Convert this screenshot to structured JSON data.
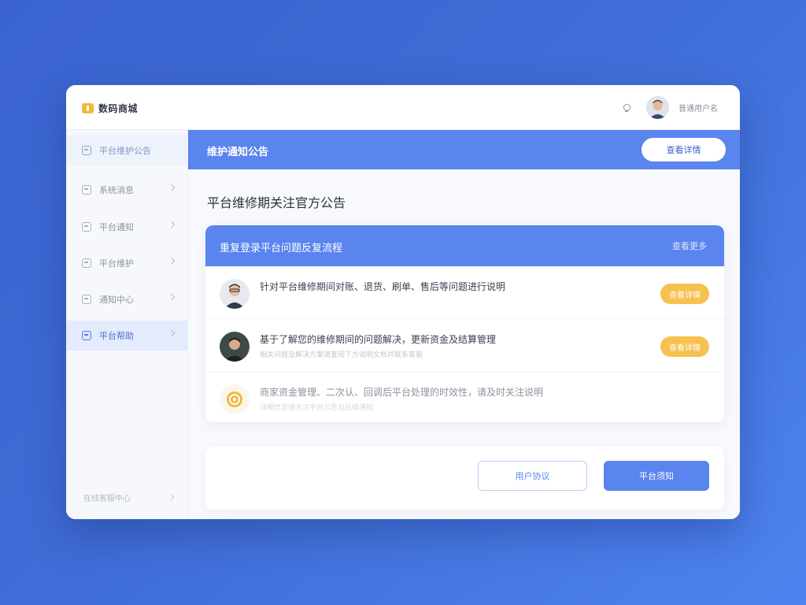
{
  "app": {
    "title": "数码商城"
  },
  "header": {
    "username": "普通用户名"
  },
  "sidebar": {
    "items": [
      {
        "label": "平台维护公告",
        "active": false
      },
      {
        "label": "系统消息",
        "active": false
      },
      {
        "label": "平台通知",
        "active": false
      },
      {
        "label": "平台维护",
        "active": false
      },
      {
        "label": "通知中心",
        "active": false
      },
      {
        "label": "平台帮助",
        "active": true
      }
    ],
    "footer": "在线客服中心"
  },
  "banner": {
    "title": "维护通知公告",
    "button_label": "查看详情"
  },
  "page_title": "平台维修期关注官方公告",
  "card": {
    "title": "重复登录平台问题反复流程",
    "link": "查看更多",
    "rows": [
      {
        "text": "针对平台维修期间对账、退货、刷单、售后等问题进行说明",
        "sub": "",
        "button": "查看详情"
      },
      {
        "text": "基于了解您的维修期间的问题解决，更新资金及结算管理",
        "sub": "相关问题及解决方案请查阅下方说明文档并联系客服",
        "button": "查看详情"
      },
      {
        "text": "商家资金管理、二次认、回调后平台处理的时效性，请及时关注说明",
        "sub": "详细信息请关注平台公告及后续通知",
        "button": ""
      }
    ]
  },
  "actions": {
    "secondary": "用户协议",
    "primary": "平台须知"
  },
  "colors": {
    "accent": "#5a84ee",
    "button_yellow": "#f6c14f"
  }
}
